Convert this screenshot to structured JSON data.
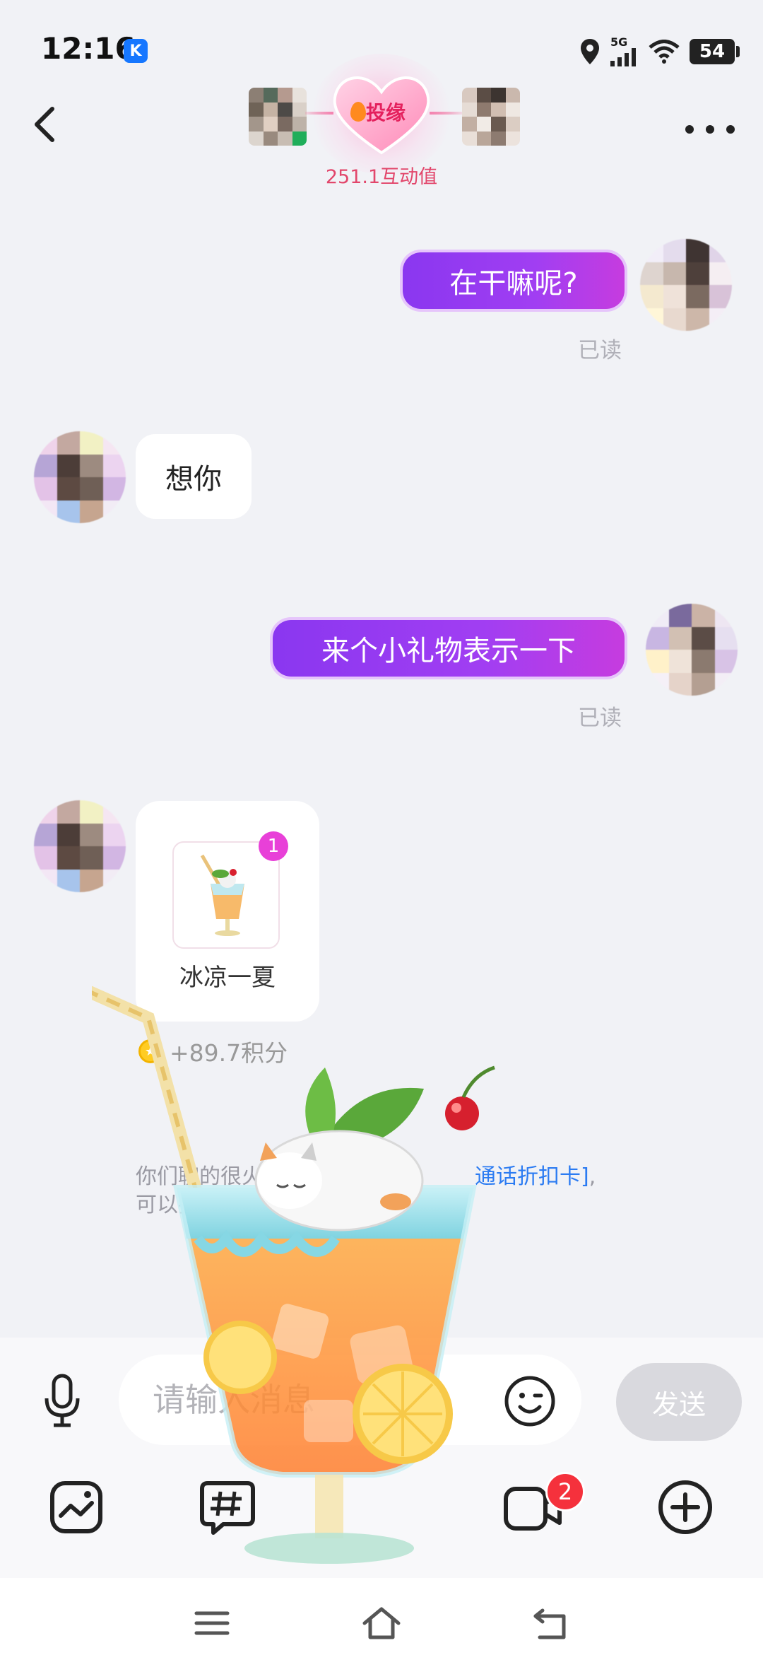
{
  "status_bar": {
    "time": "12:16",
    "k_badge": "K",
    "network": "5G",
    "battery": "54"
  },
  "header": {
    "badge_text": "投缘",
    "intimacy_text": "251.1互动值"
  },
  "messages": [
    {
      "direction": "out",
      "text": "在干嘛呢?",
      "status": "已读"
    },
    {
      "direction": "in",
      "text": "想你"
    },
    {
      "direction": "out",
      "text": "来个小礼物表示一下",
      "status": "已读"
    }
  ],
  "gift": {
    "name": "冰凉一夏",
    "count": "1",
    "points": "+89.7积分"
  },
  "system_note": {
    "line1_prefix": "你们聊的很火热",
    "line1_link": "通话折扣卡]",
    "line1_suffix": ",",
    "line2": "可以折扣价"
  },
  "input": {
    "placeholder": "请输入消息",
    "send_label": "发送"
  },
  "toolbar": {
    "video_badge": "2"
  },
  "colors": {
    "accent_purple": "#8a37f0",
    "accent_pink": "#e840d8",
    "badge_red": "#f5313c",
    "link_blue": "#2b7bf2"
  },
  "icons": [
    "back-icon",
    "more-icon",
    "mic-icon",
    "emoji-icon",
    "image-icon",
    "topic-icon",
    "video-call-icon",
    "plus-icon",
    "menu-icon",
    "home-icon",
    "back-nav-icon"
  ]
}
